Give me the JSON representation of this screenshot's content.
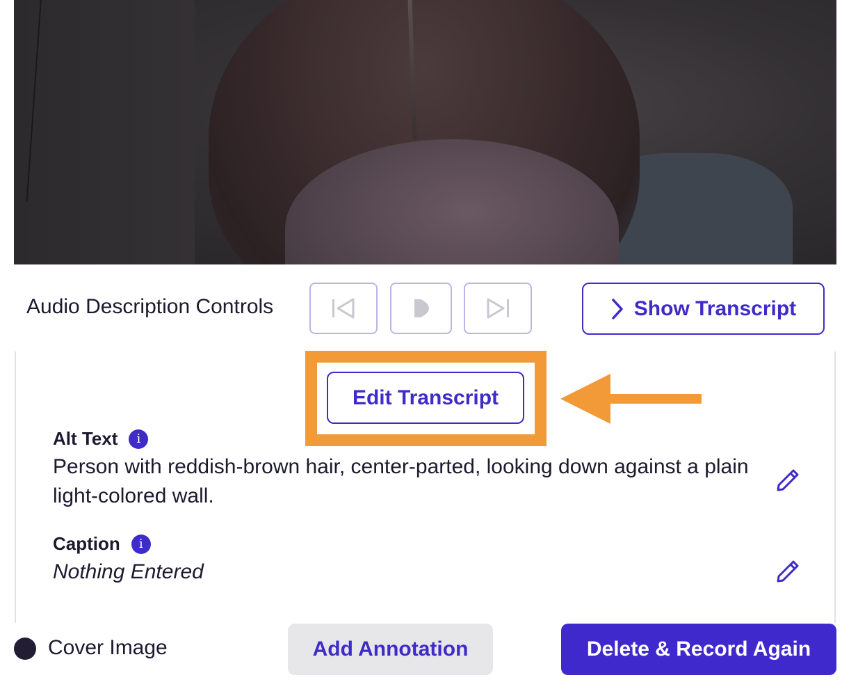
{
  "controls": {
    "label": "Audio Description Controls",
    "show_transcript_label": "Show Transcript"
  },
  "panel": {
    "edit_transcript_label": "Edit Transcript",
    "alt_text": {
      "label": "Alt Text",
      "value": "Person with reddish-brown hair, center-parted, looking down against a plain light-colored wall."
    },
    "caption": {
      "label": "Caption",
      "value": "Nothing Entered"
    }
  },
  "footer": {
    "cover_image_label": "Cover Image",
    "add_annotation_label": "Add Annotation",
    "delete_record_label": "Delete & Record Again"
  },
  "colors": {
    "accent": "#3e2bc8",
    "highlight": "#f29a38",
    "control_border": "#b9b6e6",
    "secondary_button_bg": "#e7e7ea"
  },
  "icons": {
    "previous": "skip-previous-icon",
    "play": "play-icon",
    "next": "skip-next-icon",
    "chevron": "chevron-right-icon",
    "info": "info-icon",
    "edit": "pencil-icon",
    "cover": "filled-circle-icon"
  }
}
